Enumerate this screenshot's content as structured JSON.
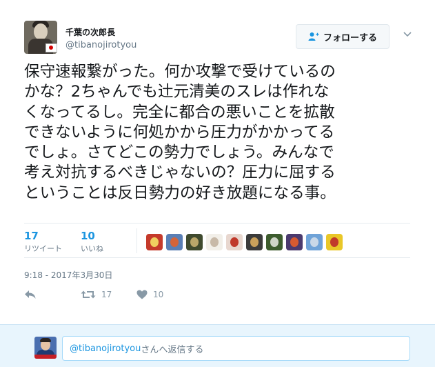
{
  "user": {
    "display_name": "千葉の次郎長",
    "username": "@tibanojirotyou"
  },
  "follow_button": {
    "label": "フォローする",
    "icon": "add-user-icon"
  },
  "tweet": {
    "text": "保守速報繋がった。何か攻撃で受けているの\nかな？2ちゃんでも辻元清美のスレは作れな\nくなってるし。完全に都合の悪いことを拡散\nできないように何処かから圧力がかかってる\nでしょ。さてどこの勢力でしょう。みんなで\n考え対抗するべきじゃないの？圧力に屈する\nということは反日勢力の好き放題になる事。",
    "timestamp": "9:18 - 2017年3月30日"
  },
  "stats": {
    "retweets": {
      "count": "17",
      "label": "リツイート"
    },
    "likes": {
      "count": "10",
      "label": "いいね"
    }
  },
  "liker_avatars": [
    {
      "name": "liker-avatar-1",
      "bg": "#c53a2b",
      "fg": "#f0d060"
    },
    {
      "name": "liker-avatar-2",
      "bg": "#5a7fb5",
      "fg": "#d4643a"
    },
    {
      "name": "liker-avatar-3",
      "bg": "#3f4a2e",
      "fg": "#b9a66a"
    },
    {
      "name": "liker-avatar-4",
      "bg": "#f2efe9",
      "fg": "#c8b9a8"
    },
    {
      "name": "liker-avatar-5",
      "bg": "#e8d7cf",
      "fg": "#c0392b"
    },
    {
      "name": "liker-avatar-6",
      "bg": "#3b3b3b",
      "fg": "#c9a05b"
    },
    {
      "name": "liker-avatar-7",
      "bg": "#3d5c2e",
      "fg": "#cfd5c8"
    },
    {
      "name": "liker-avatar-8",
      "bg": "#4b3a6e",
      "fg": "#d65a31"
    },
    {
      "name": "liker-avatar-9",
      "bg": "#6fa3d8",
      "fg": "#c9d8e8"
    },
    {
      "name": "liker-avatar-10",
      "bg": "#e9c728",
      "fg": "#c0392b"
    }
  ],
  "actions": {
    "reply": {
      "icon": "reply-icon"
    },
    "retweet": {
      "icon": "retweet-icon",
      "count": "17"
    },
    "like": {
      "icon": "heart-icon",
      "count": "10"
    }
  },
  "reply_box": {
    "mention": "@tibanojirotyou",
    "suffix": "さんへ返信する"
  },
  "colors": {
    "accent": "#1b95e0",
    "muted": "#657786",
    "reply_bar_bg": "#e8f5fd"
  }
}
